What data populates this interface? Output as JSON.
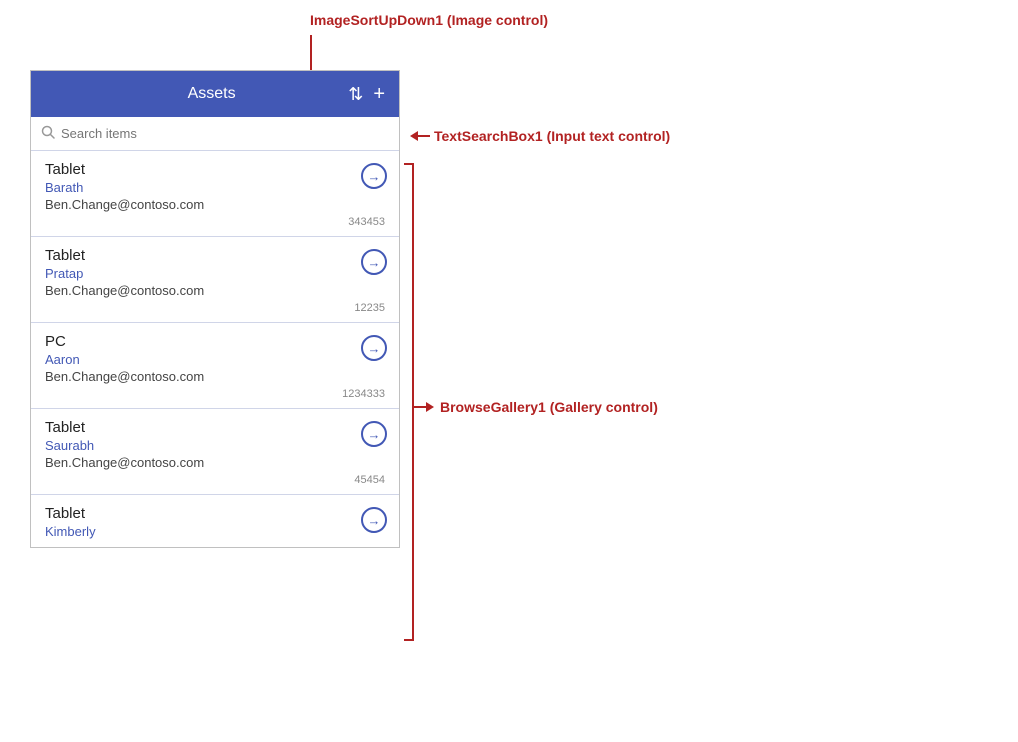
{
  "annotations": {
    "sort_label": "ImageSortUpDown1 (Image control)",
    "search_label": "TextSearchBox1 (Input text control)",
    "gallery_label": "BrowseGallery1 (Gallery control)"
  },
  "panel": {
    "header": {
      "title": "Assets",
      "sort_icon": "⇅",
      "add_icon": "+"
    },
    "search": {
      "placeholder": "Search items"
    },
    "items": [
      {
        "title": "Tablet",
        "name": "Barath",
        "email": "Ben.Change@contoso.com",
        "number": "343453"
      },
      {
        "title": "Tablet",
        "name": "Pratap",
        "email": "Ben.Change@contoso.com",
        "number": "12235"
      },
      {
        "title": "PC",
        "name": "Aaron",
        "email": "Ben.Change@contoso.com",
        "number": "1234333"
      },
      {
        "title": "Tablet",
        "name": "Saurabh",
        "email": "Ben.Change@contoso.com",
        "number": "45454"
      },
      {
        "title": "Tablet",
        "name": "Kimberly",
        "email": "",
        "number": ""
      }
    ]
  }
}
